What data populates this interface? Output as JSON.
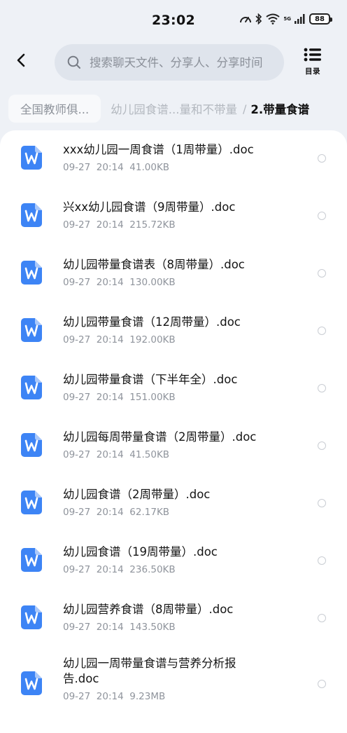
{
  "status_bar": {
    "time": "23:02",
    "battery": "88",
    "network": "5G"
  },
  "header": {
    "search_placeholder": "搜索聊天文件、分享人、分享时间",
    "catalog_label": "目录"
  },
  "breadcrumb": {
    "first": "全国教师俱...",
    "middle": "幼儿园食谱...量和不带量",
    "separator": "/",
    "current": "2.带量食谱"
  },
  "files": [
    {
      "name": "xxx幼儿园一周食谱（1周带量）.doc",
      "meta": "09-27  20:14  41.00KB"
    },
    {
      "name": "兴xx幼儿园食谱（9周带量）.doc",
      "meta": "09-27  20:14  215.72KB"
    },
    {
      "name": "幼儿园带量食谱表（8周带量）.doc",
      "meta": "09-27  20:14  130.00KB"
    },
    {
      "name": "幼儿园带量食谱（12周带量）.doc",
      "meta": "09-27  20:14  192.00KB"
    },
    {
      "name": "幼儿园带量食谱（下半年全）.doc",
      "meta": "09-27  20:14  151.00KB"
    },
    {
      "name": "幼儿园每周带量食谱（2周带量）.doc",
      "meta": "09-27  20:14  41.50KB"
    },
    {
      "name": "幼儿园食谱（2周带量）.doc",
      "meta": "09-27  20:14  62.17KB"
    },
    {
      "name": "幼儿园食谱（19周带量）.doc",
      "meta": "09-27  20:14  236.50KB"
    },
    {
      "name": "幼儿园营养食谱（8周带量）.doc",
      "meta": "09-27  20:14  143.50KB"
    },
    {
      "name": "幼儿园一周带量食谱与营养分析报告.doc",
      "meta": "09-27  20:14  9.23MB"
    }
  ],
  "colors": {
    "file_icon": "#3d84f5",
    "background": "#eef1f6"
  },
  "icons": {
    "back": "chevron-left-icon",
    "search": "search-icon",
    "catalog": "list-icon",
    "file": "word-doc-icon"
  }
}
